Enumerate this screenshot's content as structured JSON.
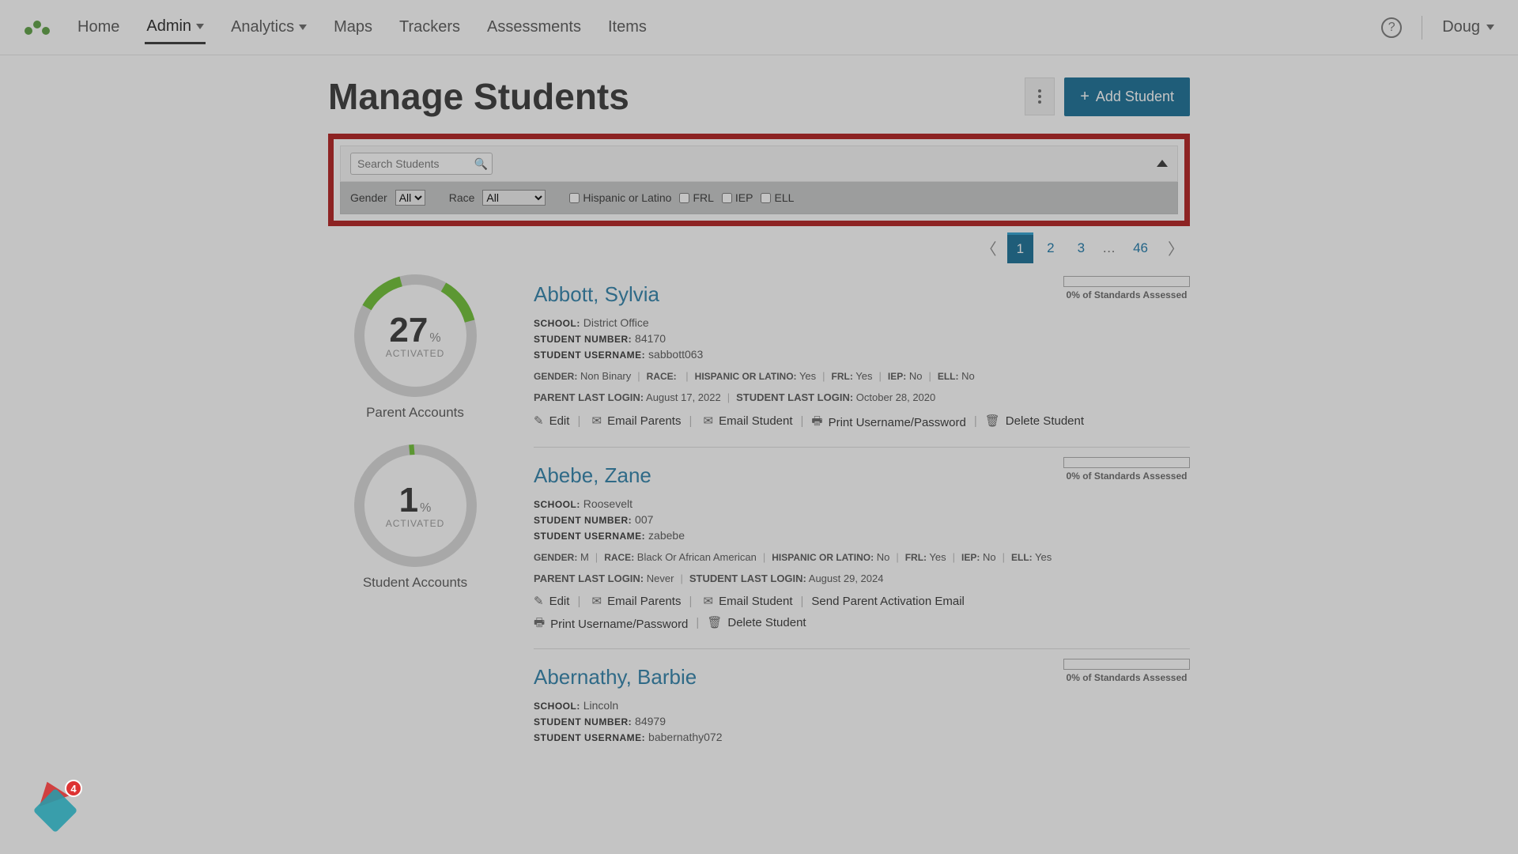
{
  "nav": {
    "items": [
      "Home",
      "Admin",
      "Analytics",
      "Maps",
      "Trackers",
      "Assessments",
      "Items"
    ],
    "active": "Admin",
    "user": "Doug"
  },
  "page": {
    "title": "Manage Students",
    "add_button": "Add Student"
  },
  "filters": {
    "search_placeholder": "Search Students",
    "gender_label": "Gender",
    "gender_value": "All",
    "race_label": "Race",
    "race_value": "All",
    "hispanic_label": "Hispanic or Latino",
    "frl_label": "FRL",
    "iep_label": "IEP",
    "ell_label": "ELL"
  },
  "pagination": {
    "pages": [
      "1",
      "2",
      "3"
    ],
    "ellipsis": "…",
    "last": "46",
    "current": "1"
  },
  "donuts": {
    "parent": {
      "value": "27",
      "pct": "%",
      "sub": "ACTIVATED",
      "label": "Parent Accounts"
    },
    "student": {
      "value": "1",
      "pct": "%",
      "sub": "ACTIVATED",
      "label": "Student Accounts"
    }
  },
  "labels": {
    "school": "SCHOOL:",
    "student_number": "STUDENT NUMBER:",
    "student_username": "STUDENT USERNAME:",
    "gender": "GENDER:",
    "race": "RACE:",
    "hisp": "HISPANIC OR LATINO:",
    "frl": "FRL:",
    "iep": "IEP:",
    "ell": "ELL:",
    "parent_login": "PARENT LAST LOGIN:",
    "student_login": "STUDENT LAST LOGIN:",
    "progress": "0% of Standards Assessed",
    "edit": "Edit",
    "email_parents": "Email Parents",
    "email_student": "Email Student",
    "print": "Print Username/Password",
    "delete": "Delete Student",
    "send_activation": "Send Parent Activation Email"
  },
  "students": [
    {
      "name": "Abbott, Sylvia",
      "school": "District Office",
      "number": "84170",
      "username": "sabbott063",
      "gender": "Non Binary",
      "race": "",
      "hisp": "Yes",
      "frl": "Yes",
      "iep": "No",
      "ell": "No",
      "parent_login": "August 17, 2022",
      "student_login": "October 28, 2020",
      "has_activation": false
    },
    {
      "name": "Abebe, Zane",
      "school": "Roosevelt",
      "number": "007",
      "username": "zabebe",
      "gender": "M",
      "race": "Black Or African American",
      "hisp": "No",
      "frl": "Yes",
      "iep": "No",
      "ell": "Yes",
      "parent_login": "Never",
      "student_login": "August 29, 2024",
      "has_activation": true
    },
    {
      "name": "Abernathy, Barbie",
      "school": "Lincoln",
      "number": "84979",
      "username": "babernathy072",
      "gender": "",
      "race": "",
      "hisp": "",
      "frl": "",
      "iep": "",
      "ell": "",
      "parent_login": "",
      "student_login": "",
      "has_activation": false,
      "truncated": true
    }
  ],
  "notif_count": "4"
}
